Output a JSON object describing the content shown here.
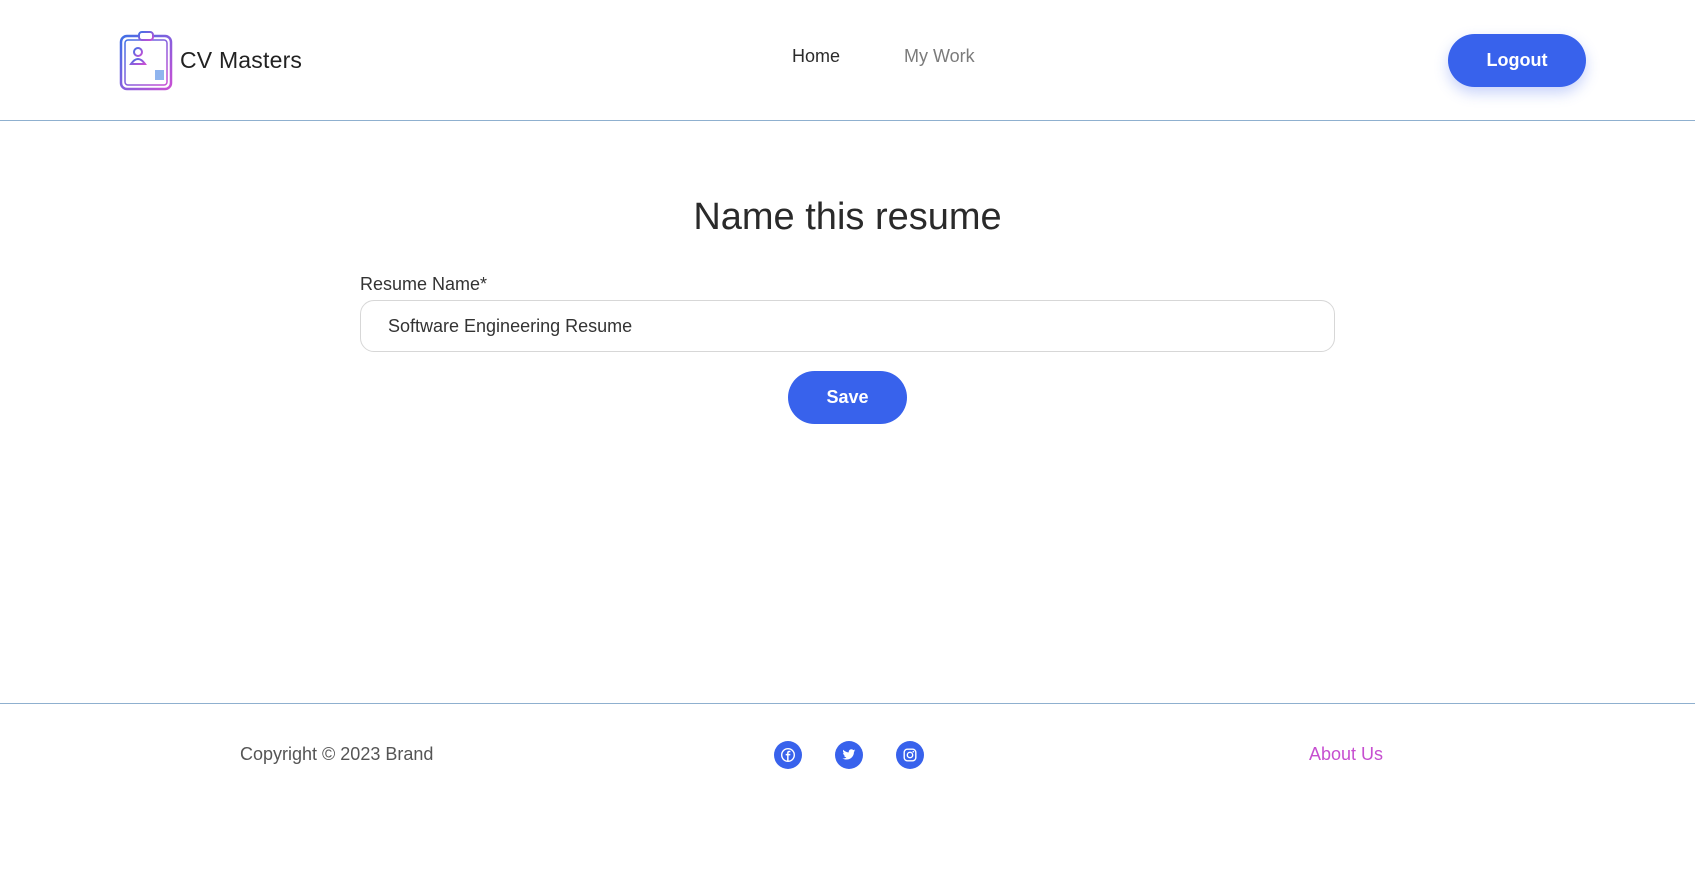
{
  "header": {
    "brand_name": "CV Masters",
    "nav": {
      "home_label": "Home",
      "my_work_label": "My Work"
    },
    "logout_label": "Logout"
  },
  "main": {
    "title": "Name this resume",
    "resume_name_label": "Resume Name*",
    "resume_name_value": "Software Engineering Resume",
    "save_label": "Save"
  },
  "footer": {
    "copyright": "Copyright © 2023 Brand",
    "social_icons": [
      "facebook-icon",
      "twitter-icon",
      "instagram-icon"
    ],
    "about_label": "About Us"
  },
  "colors": {
    "accent": "#3862ec",
    "link_purple": "#c64fd0",
    "divider": "#8fb0cf"
  }
}
